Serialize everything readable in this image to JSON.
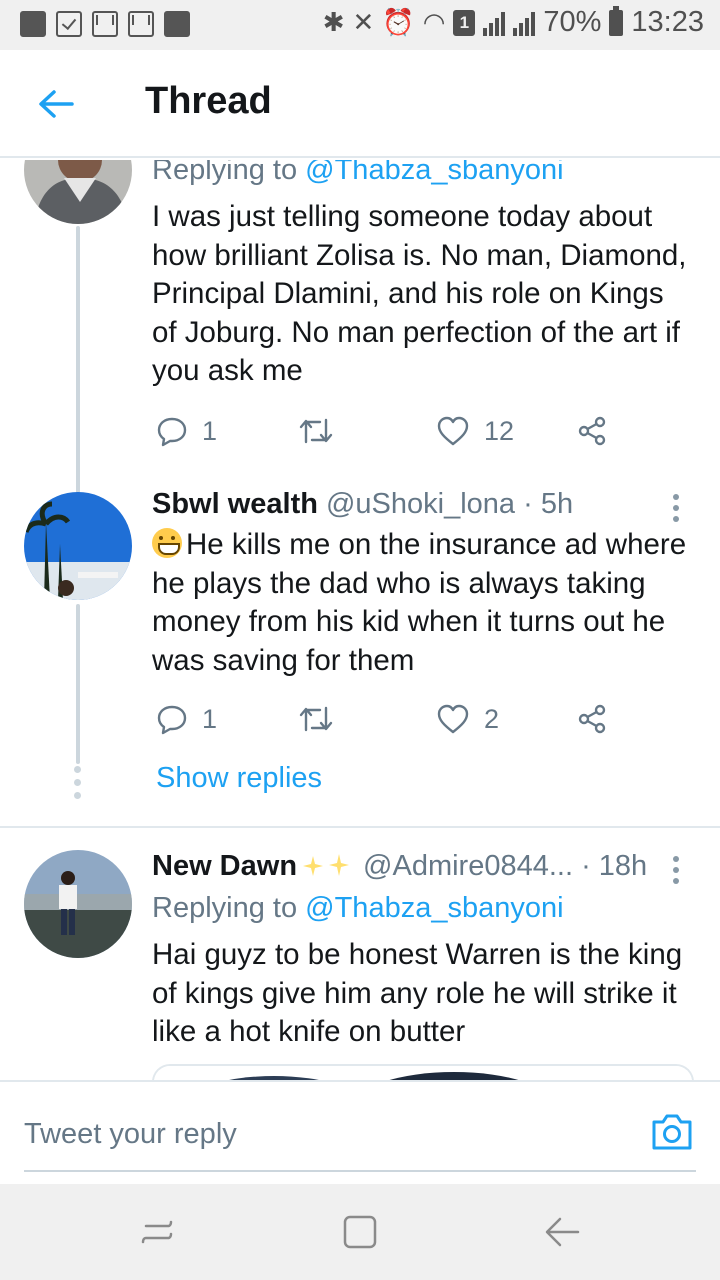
{
  "status_bar": {
    "battery": "70%",
    "time": "13:23",
    "sim_badge": "1"
  },
  "header": {
    "title": "Thread"
  },
  "tweets": [
    {
      "replying_prefix": "Replying to ",
      "replying_handle": "@Thabza_sbanyoni",
      "text": "I was just telling someone today about how brilliant Zolisa is. No man, Diamond, Principal Dlamini, and his role on Kings of Joburg. No man perfection of the art if you ask me",
      "reply_count": "1",
      "like_count": "12"
    },
    {
      "name": "Sbwl wealth",
      "handle_time": "@uShoki_lona · 5h",
      "text": "He kills me on the insurance ad where he plays the dad who is always taking money from his kid when it turns out he was saving for them",
      "reply_count": "1",
      "like_count": "2"
    },
    {
      "name": "New Dawn",
      "handle_time": "@Admire0844... · 18h",
      "replying_prefix": "Replying to ",
      "replying_handle": "@Thabza_sbanyoni",
      "text": "Hai guyz to be honest Warren is the king of kings give him any role he will strike it like a hot knife on butter"
    }
  ],
  "show_replies": "Show replies",
  "composer": {
    "placeholder": "Tweet your reply"
  },
  "icons": {
    "back": "arrow-left-icon",
    "reply": "reply-icon",
    "retweet": "retweet-icon",
    "like": "heart-icon",
    "share": "share-icon",
    "camera": "camera-icon",
    "more": "more-vertical-icon"
  },
  "colors": {
    "accent": "#1da1f2",
    "secondary_text": "#657786",
    "thread_line": "#ccd6dd"
  }
}
